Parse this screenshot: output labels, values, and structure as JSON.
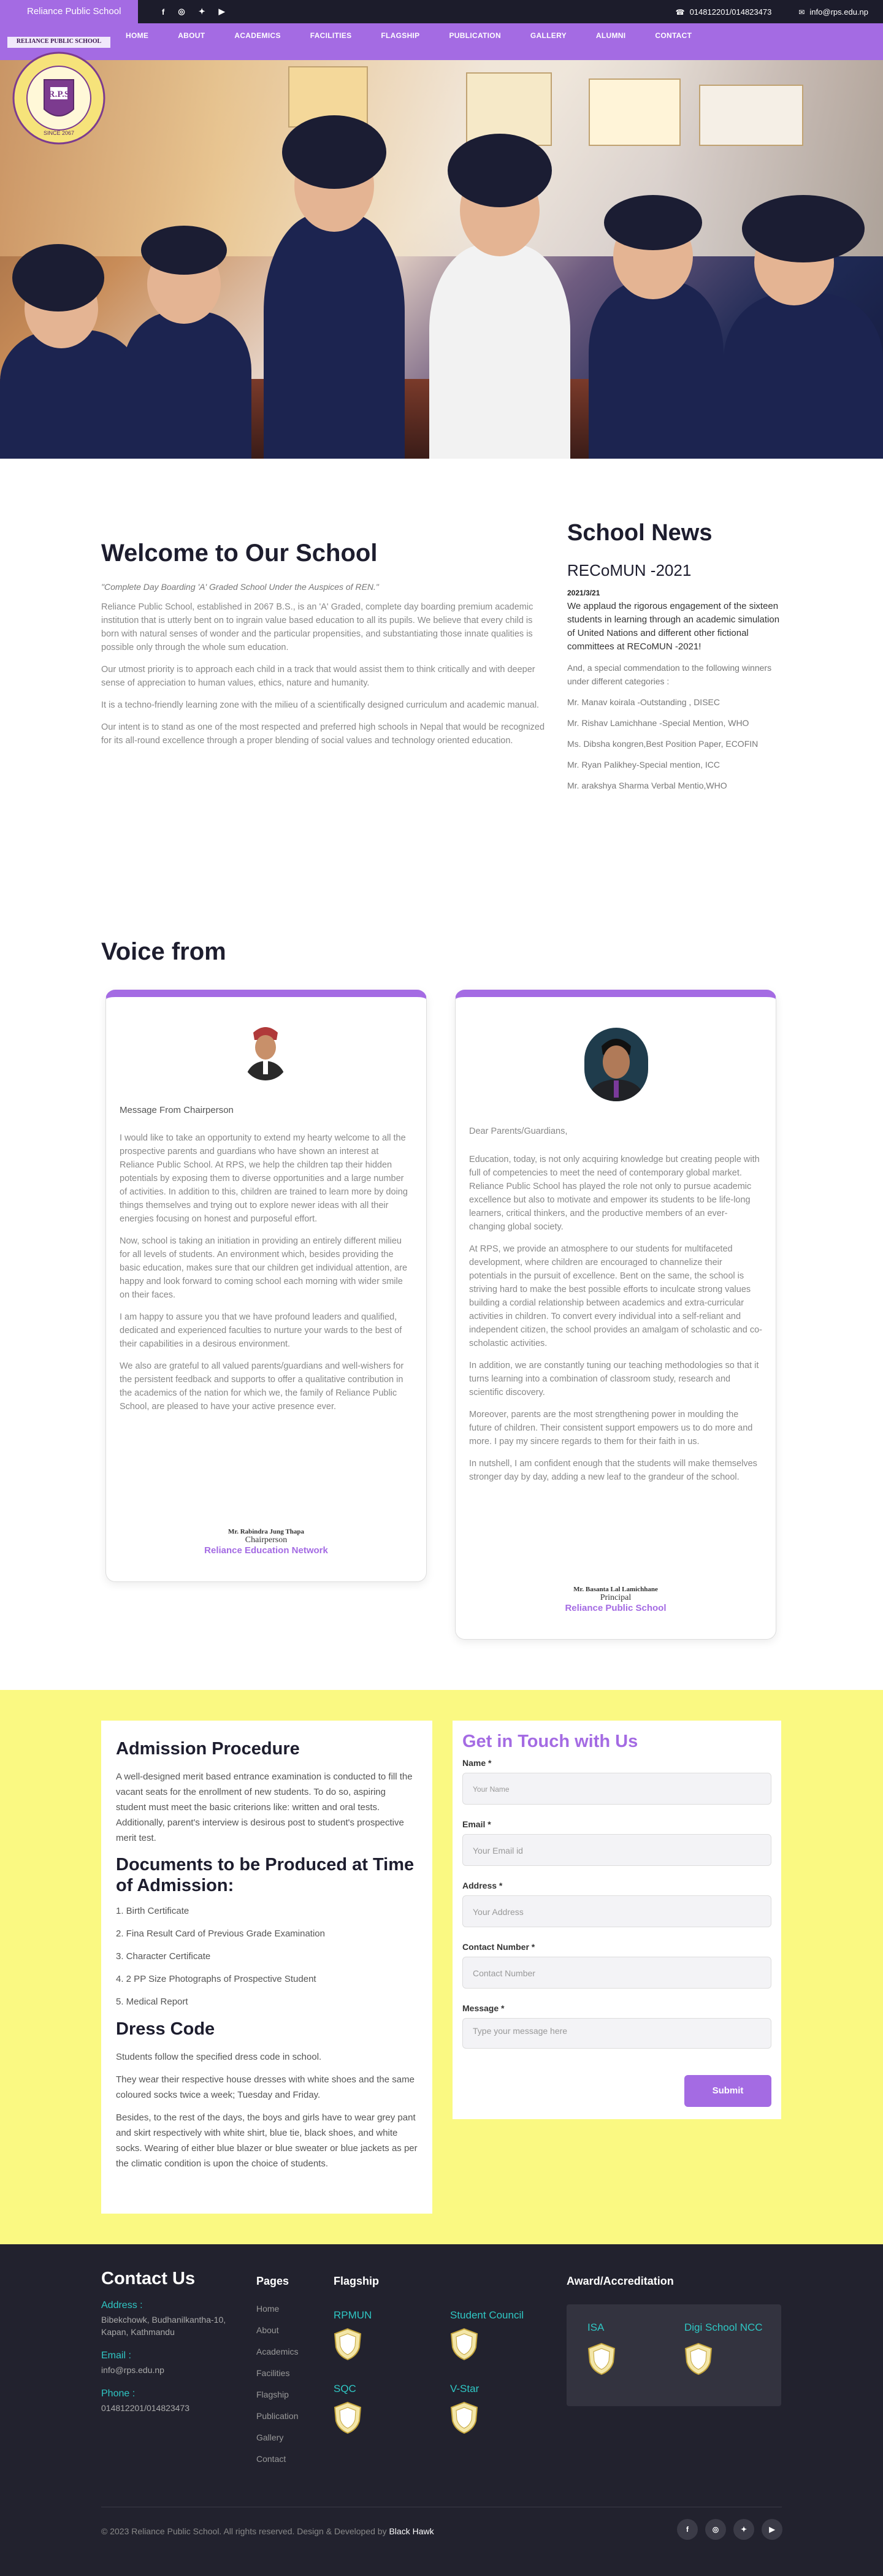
{
  "topbar": {
    "brand": "Reliance Public School",
    "socials": [
      "f",
      "◎",
      "✦",
      "▶"
    ],
    "phone": "014812201/014823473",
    "email": "info@rps.edu.np"
  },
  "nav": [
    "HOME",
    "ABOUT",
    "ACADEMICS",
    "FACILITIES",
    "FLAGSHIP",
    "PUBLICATION",
    "GALLERY",
    "ALUMNI",
    "CONTACT"
  ],
  "logo": {
    "top": "RELIANCE PUBLIC SCHOOL",
    "mid": "R.P.S",
    "bottom": "SINCE 2067"
  },
  "welcome": {
    "title": "Welcome to Our School",
    "tagline": "\"Complete Day Boarding 'A' Graded School Under the Auspices of REN.\"",
    "paragraphs": [
      "Reliance Public School, established in 2067 B.S., is an 'A' Graded, complete day boarding premium academic institution that is utterly bent on to ingrain value based education to all its pupils. We believe that every child is born with natural senses of wonder and the particular propensities, and substantiating those innate qualities is possible only through the whole sum education.",
      "Our utmost priority is to approach each child in a track that would assist them to think critically and with deeper sense of appreciation to human values, ethics, nature and humanity.",
      "It is a techno-friendly learning zone with the milieu of a scientifically designed curriculum and academic manual.",
      "Our intent is to stand as one of the most respected and preferred high schools in Nepal that would be recognized for its all-round excellence through a proper blending of social values and technology oriented education."
    ]
  },
  "news": {
    "title": "School News",
    "headline": "RECoMUN -2021",
    "date": "2021/3/21",
    "lead": "We applaud the rigorous engagement of the sixteen students in learning through an academic simulation of United Nations and different other fictional committees at RECoMUN -2021!",
    "commend": "And, a special commendation to the following winners under different categories :",
    "winners": [
      "Mr. Manav koirala -Outstanding , DISEC",
      "Mr. Rishav Lamichhane -Special Mention, WHO",
      "Ms. Dibsha kongren,Best Position Paper, ECOFIN",
      "Mr. Ryan Palikhey-Special mention, ICC",
      "Mr. arakshya Sharma Verbal Mentio,WHO"
    ]
  },
  "voice": {
    "title": "Voice from",
    "chair": {
      "label": "Message From Chairperson",
      "paragraphs": [
        "I would like to take an opportunity to extend my hearty welcome to all the prospective parents and guardians who have shown an interest at Reliance Public School. At RPS, we help the children tap their hidden potentials by exposing them to diverse opportunities and a large number of activities. In addition to this, children are trained to learn more by doing things themselves and trying out to explore newer ideas with all their energies focusing on honest and purposeful effort.",
        "Now, school is taking an initiation in providing an entirely different milieu for all levels of students. An environment which, besides providing the basic education, makes sure that our children get individual attention, are happy and look forward to coming school each morning with wider smile on their faces.",
        "I am happy to assure you that we have profound leaders and qualified, dedicated and experienced faculties to nurture your wards to the best of their capabilities in a desirous environment.",
        "We also are grateful to all valued parents/guardians and well-wishers for the persistent feedback and supports to offer a qualitative contribution in the academics of the nation for which we, the family of Reliance Public School, are pleased to have your active presence ever."
      ],
      "name": "Mr. Rabindra Jung Thapa",
      "role": "Chairperson",
      "org": "Reliance Education Network"
    },
    "principal": {
      "greeting": "Dear Parents/Guardians,",
      "paragraphs": [
        "Education, today, is not only acquiring knowledge but creating people with full of competencies to meet the need of contemporary global market. Reliance Public School has played the role not only to pursue academic excellence but also to motivate and empower its students to be life-long learners, critical thinkers, and the productive members of an ever-changing global society.",
        "At RPS, we provide an atmosphere to our students for multifaceted development, where children are encouraged to channelize their potentials in the pursuit of excellence. Bent on the same, the school is striving hard to make the best possible efforts to inculcate strong values building a cordial relationship between academics and extra-curricular activities in children. To convert every individual into a self-reliant and independent citizen, the school provides an amalgam of scholastic and co-scholastic activities.",
        "In addition, we are constantly tuning our teaching methodologies so that it turns learning into a  combination of classroom study, research and scientific discovery.",
        "Moreover, parents are the most strengthening power in moulding the future of children. Their consistent support empowers us to do more and more. I pay my sincere regards to them for their faith in us.",
        "In nutshell, I am confident enough that the students will make themselves stronger day by day, adding a new leaf to the grandeur of the school."
      ],
      "name": "Mr. Basanta Lal Lamichhane",
      "role": "Principal",
      "org": "Reliance Public School"
    }
  },
  "admission": {
    "title": "Admission Procedure",
    "text": "A well-designed merit based entrance examination is conducted to fill the vacant seats for the enrollment of new students. To do so, aspiring student must meet the basic criterions like: written and oral tests. Additionally, parent's interview is desirous post to student's prospective merit test.",
    "docs_title": "Documents to be Produced at Time of Admission:",
    "docs": [
      "1. Birth Certificate",
      "2. Fina Result Card of Previous Grade Examination",
      "3. Character Certificate",
      "4. 2 PP Size Photographs of Prospective Student",
      "5. Medical Report"
    ],
    "dress_title": "Dress Code",
    "dress": [
      "Students follow the specified dress code in school.",
      "They wear their respective house dresses with white shoes and the same coloured socks twice a week; Tuesday and Friday.",
      "Besides, to the rest of the days, the boys and girls have to wear grey pant and skirt respectively with white shirt, blue tie, black shoes, and white socks. Wearing of either blue blazer or blue sweater or blue jackets as per the climatic condition is upon the choice of students."
    ]
  },
  "contact_form": {
    "title": "Get in Touch with Us",
    "fields": [
      {
        "label": "Name *",
        "placeholder": "Your Name"
      },
      {
        "label": "Email *",
        "placeholder": "Your Email id"
      },
      {
        "label": "Address *",
        "placeholder": "Your Address"
      },
      {
        "label": "Contact Number *",
        "placeholder": "Contact Number"
      },
      {
        "label": "Message *",
        "placeholder": "Type your message here"
      }
    ],
    "submit": "Submit"
  },
  "footer": {
    "contact_title": "Contact Us",
    "address_label": "Address :",
    "address": "Bibekchowk, Budhanilkantha-10, Kapan, Kathmandu",
    "email_label": "Email :",
    "email": "info@rps.edu.np",
    "phone_label": "Phone :",
    "phone": "014812201/014823473",
    "pages_title": "Pages",
    "pages": [
      "Home",
      "About",
      "Academics",
      "Facilities",
      "Flagship",
      "Publication",
      "Gallery",
      "Contact"
    ],
    "flagship_title": "Flagship",
    "flagship": [
      "RPMUN",
      "Student Council",
      "SQC",
      "V-Star"
    ],
    "award_title": "Award/Accreditation",
    "awards": [
      "ISA",
      "Digi School NCC"
    ],
    "copyright": "© 2023 Reliance Public School. All rights reserved. Design & Developed by",
    "developer": "Black Hawk",
    "socials": [
      "f",
      "◎",
      "✦",
      "▶"
    ]
  },
  "colors": {
    "accent": "#a46be3",
    "dark": "#22222e",
    "yellow": "#faf982",
    "teal": "#2fc7c4"
  }
}
